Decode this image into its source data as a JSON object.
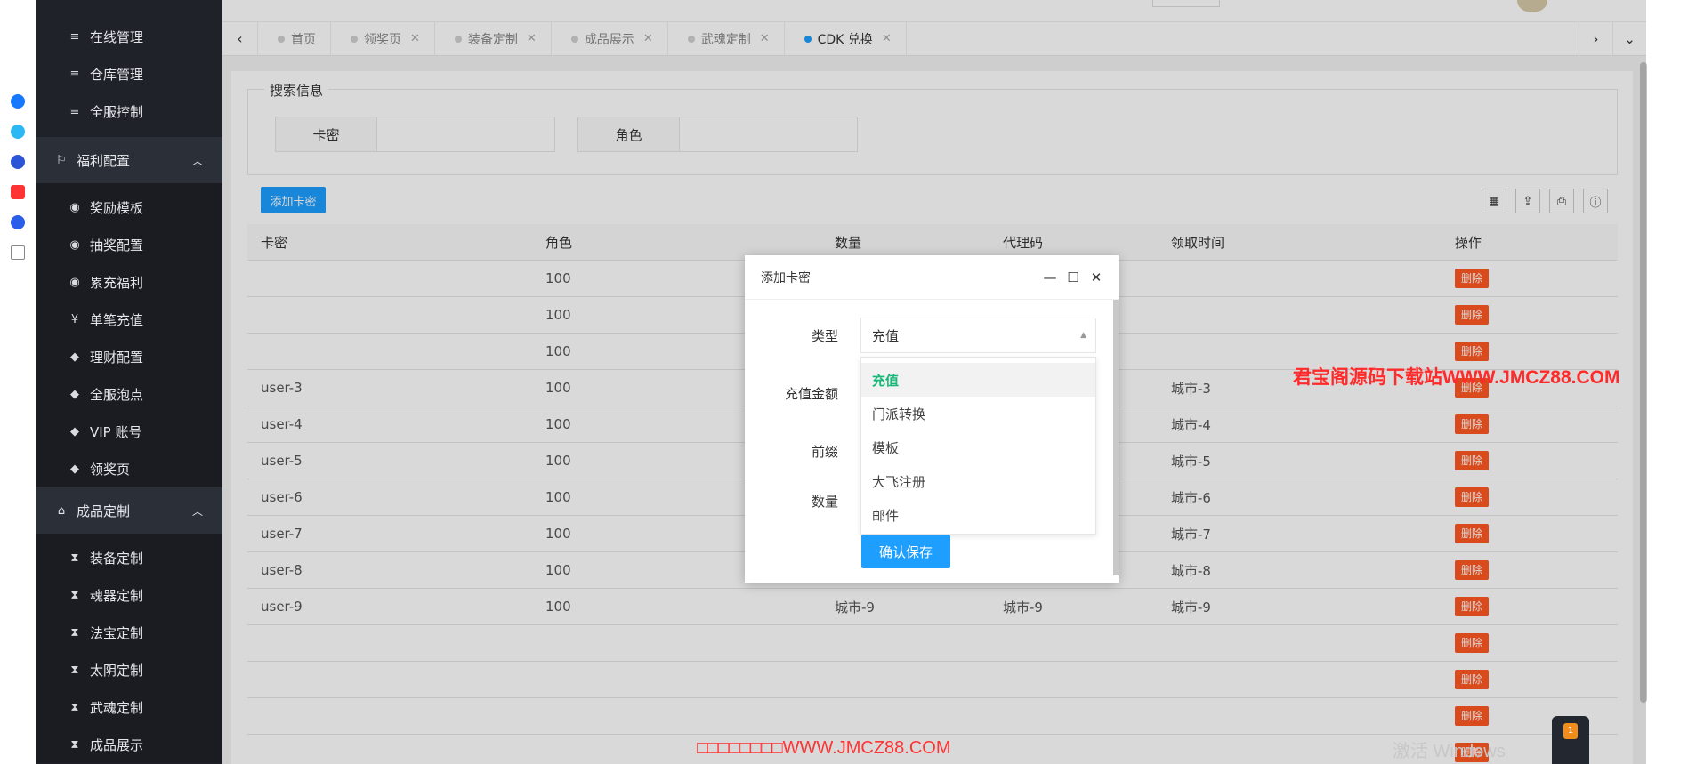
{
  "sidebar": {
    "items_top": [
      {
        "label": "在线管理",
        "icon": "menu-icon"
      },
      {
        "label": "仓库管理",
        "icon": "menu-icon"
      },
      {
        "label": "全服控制",
        "icon": "menu-icon"
      }
    ],
    "group1": {
      "label": "福利配置",
      "icon": "flag-icon"
    },
    "group1_items": [
      {
        "label": "奖励模板",
        "icon": "palette-icon"
      },
      {
        "label": "抽奖配置",
        "icon": "palette-icon"
      },
      {
        "label": "累充福利",
        "icon": "palette-icon"
      },
      {
        "label": "单笔充值",
        "icon": "yen-icon"
      },
      {
        "label": "理财配置",
        "icon": "tag-icon"
      },
      {
        "label": "全服泡点",
        "icon": "tag-icon"
      },
      {
        "label": "VIP 账号",
        "icon": "tag-icon"
      },
      {
        "label": "领奖页",
        "icon": "tag-icon"
      }
    ],
    "group2": {
      "label": "成品定制",
      "icon": "home-icon"
    },
    "group2_items": [
      {
        "label": "装备定制",
        "icon": "hourglass-icon"
      },
      {
        "label": "魂器定制",
        "icon": "hourglass-icon"
      },
      {
        "label": "法宝定制",
        "icon": "hourglass-icon"
      },
      {
        "label": "太阴定制",
        "icon": "hourglass-icon"
      },
      {
        "label": "武魂定制",
        "icon": "hourglass-icon"
      },
      {
        "label": "成品展示",
        "icon": "hourglass-icon"
      }
    ]
  },
  "tabs": [
    {
      "label": "首页",
      "closable": false
    },
    {
      "label": "领奖页",
      "closable": true
    },
    {
      "label": "装备定制",
      "closable": true
    },
    {
      "label": "成品展示",
      "closable": true
    },
    {
      "label": "武魂定制",
      "closable": true
    },
    {
      "label": "CDK 兑换",
      "closable": true,
      "active": true
    }
  ],
  "search": {
    "legend": "搜索信息",
    "field1_label": "卡密",
    "field2_label": "角色"
  },
  "toolbar": {
    "add_label": "添加卡密"
  },
  "table": {
    "headers": [
      "卡密",
      "角色",
      "数量",
      "代理码",
      "领取时间",
      "操作"
    ],
    "rows": [
      [
        "",
        "100",
        "",
        "",
        "",
        "删除"
      ],
      [
        "",
        "100",
        "",
        "",
        "",
        "删除"
      ],
      [
        "",
        "100",
        "",
        "",
        "",
        "删除"
      ],
      [
        "user-3",
        "100",
        "",
        "",
        "城市-3",
        "删除"
      ],
      [
        "user-4",
        "100",
        "",
        "",
        "城市-4",
        "删除"
      ],
      [
        "user-5",
        "100",
        "",
        "",
        "城市-5",
        "删除"
      ],
      [
        "user-6",
        "100",
        "",
        "",
        "城市-6",
        "删除"
      ],
      [
        "user-7",
        "100",
        "",
        "",
        "城市-7",
        "删除"
      ],
      [
        "user-8",
        "100",
        "",
        "",
        "城市-8",
        "删除"
      ],
      [
        "user-9",
        "100",
        "城市-9",
        "城市-9",
        "城市-9",
        "删除"
      ],
      [
        "",
        "",
        "",
        "",
        "",
        "删除"
      ],
      [
        "",
        "",
        "",
        "",
        "",
        "删除"
      ],
      [
        "",
        "",
        "",
        "",
        "",
        "删除"
      ],
      [
        "",
        "",
        "",
        "",
        "",
        "删除"
      ]
    ]
  },
  "modal": {
    "title": "添加卡密",
    "type_label": "类型",
    "type_value": "充值",
    "amount_label": "充值金额",
    "prefix_label": "前缀",
    "count_label": "数量",
    "options": [
      "充值",
      "门派转换",
      "模板",
      "大飞注册",
      "邮件"
    ],
    "save_label": "确认保存"
  },
  "watermarks": {
    "side": "君宝阁源码下载站WWW.JMCZ88.COM",
    "bottom": "□□□□□□□□WWW.JMCZ88.COM",
    "activate": "激活 Windows"
  },
  "fab_badge": "1"
}
